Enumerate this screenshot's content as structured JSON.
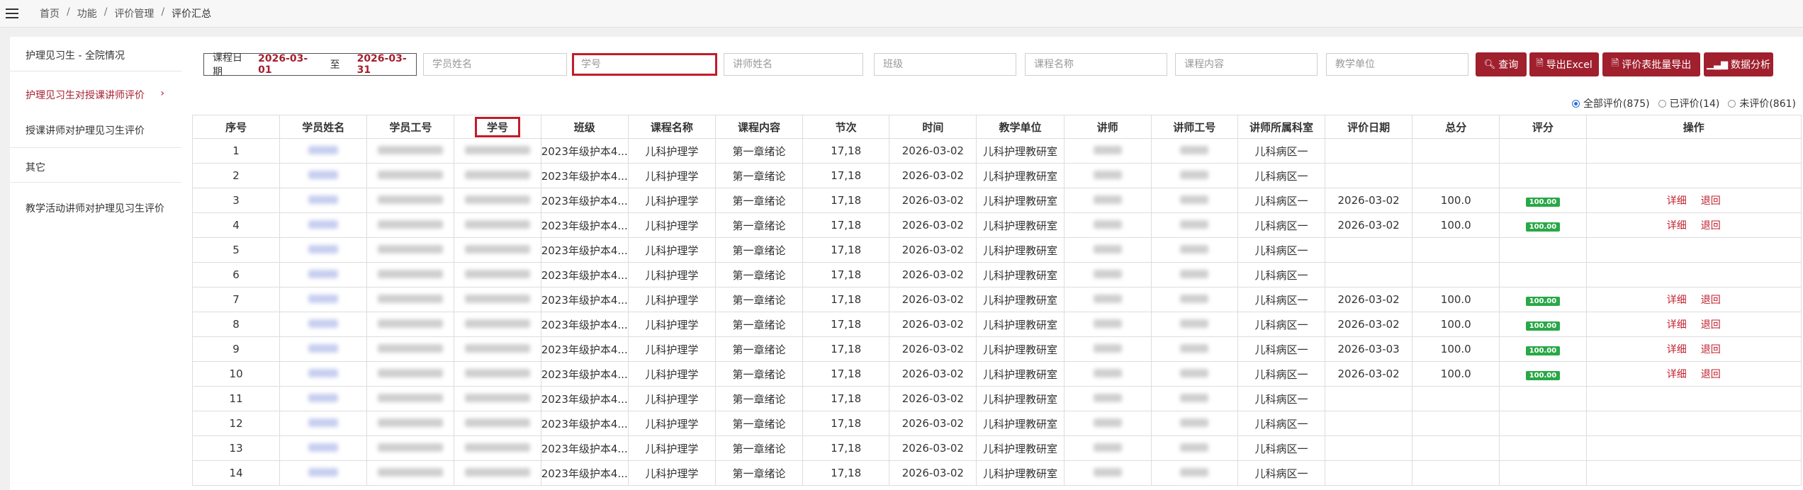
{
  "breadcrumb": [
    "首页",
    "功能",
    "评价管理",
    "评价汇总"
  ],
  "sidebar": {
    "items": [
      {
        "label": "护理见习生 - 全院情况",
        "active": false
      },
      {
        "label": "护理见习生对授课讲师评价",
        "active": true
      },
      {
        "label": "授课讲师对护理见习生评价",
        "active": false
      },
      {
        "label": "其它",
        "active": false
      },
      {
        "label": "教学活动讲师对护理见习生评价",
        "active": false
      }
    ],
    "active_chevron": "›"
  },
  "filters": {
    "date_label": "课程日期",
    "date_from": "2026-03-01",
    "date_to_word": "至",
    "date_to": "2026-03-31",
    "student_name_placeholder": "学员姓名",
    "student_no_placeholder": "学号",
    "teacher_name_placeholder": "讲师姓名",
    "class_placeholder": "班级",
    "course_name_placeholder": "课程名称",
    "course_content_placeholder": "课程内容",
    "teaching_unit_placeholder": "教学单位"
  },
  "buttons": {
    "query": "查询",
    "export_excel": "导出Excel",
    "batch_export": "评价表批量导出",
    "analysis": "数据分析"
  },
  "radios": [
    {
      "label": "全部评价(875)",
      "checked": true
    },
    {
      "label": "已评价(14)",
      "checked": false
    },
    {
      "label": "未评价(861)",
      "checked": false
    }
  ],
  "table": {
    "headers": [
      "序号",
      "学员姓名",
      "学员工号",
      "学号",
      "班级",
      "课程名称",
      "课程内容",
      "节次",
      "时间",
      "教学单位",
      "讲师",
      "讲师工号",
      "讲师所属科室",
      "评价日期",
      "总分",
      "评分",
      "操作"
    ],
    "highlighted_header": "学号",
    "ops": {
      "detail": "详细",
      "back": "退回"
    },
    "rows": [
      {
        "no": "1",
        "class": "2023年级护本4...",
        "course": "儿科护理学",
        "content": "第一章绪论",
        "section": "17,18",
        "time": "2026-03-02",
        "unit": "儿科护理教研室",
        "dept": "儿科病区一",
        "eval_date": "",
        "total": "",
        "score": ""
      },
      {
        "no": "2",
        "class": "2023年级护本4...",
        "course": "儿科护理学",
        "content": "第一章绪论",
        "section": "17,18",
        "time": "2026-03-02",
        "unit": "儿科护理教研室",
        "dept": "儿科病区一",
        "eval_date": "",
        "total": "",
        "score": ""
      },
      {
        "no": "3",
        "class": "2023年级护本4...",
        "course": "儿科护理学",
        "content": "第一章绪论",
        "section": "17,18",
        "time": "2026-03-02",
        "unit": "儿科护理教研室",
        "dept": "儿科病区一",
        "eval_date": "2026-03-02",
        "total": "100.0",
        "score": "100.00"
      },
      {
        "no": "4",
        "class": "2023年级护本4...",
        "course": "儿科护理学",
        "content": "第一章绪论",
        "section": "17,18",
        "time": "2026-03-02",
        "unit": "儿科护理教研室",
        "dept": "儿科病区一",
        "eval_date": "2026-03-02",
        "total": "100.0",
        "score": "100.00"
      },
      {
        "no": "5",
        "class": "2023年级护本4...",
        "course": "儿科护理学",
        "content": "第一章绪论",
        "section": "17,18",
        "time": "2026-03-02",
        "unit": "儿科护理教研室",
        "dept": "儿科病区一",
        "eval_date": "",
        "total": "",
        "score": ""
      },
      {
        "no": "6",
        "class": "2023年级护本4...",
        "course": "儿科护理学",
        "content": "第一章绪论",
        "section": "17,18",
        "time": "2026-03-02",
        "unit": "儿科护理教研室",
        "dept": "儿科病区一",
        "eval_date": "",
        "total": "",
        "score": ""
      },
      {
        "no": "7",
        "class": "2023年级护本4...",
        "course": "儿科护理学",
        "content": "第一章绪论",
        "section": "17,18",
        "time": "2026-03-02",
        "unit": "儿科护理教研室",
        "dept": "儿科病区一",
        "eval_date": "2026-03-02",
        "total": "100.0",
        "score": "100.00"
      },
      {
        "no": "8",
        "class": "2023年级护本4...",
        "course": "儿科护理学",
        "content": "第一章绪论",
        "section": "17,18",
        "time": "2026-03-02",
        "unit": "儿科护理教研室",
        "dept": "儿科病区一",
        "eval_date": "2026-03-02",
        "total": "100.0",
        "score": "100.00"
      },
      {
        "no": "9",
        "class": "2023年级护本4...",
        "course": "儿科护理学",
        "content": "第一章绪论",
        "section": "17,18",
        "time": "2026-03-02",
        "unit": "儿科护理教研室",
        "dept": "儿科病区一",
        "eval_date": "2026-03-03",
        "total": "100.0",
        "score": "100.00"
      },
      {
        "no": "10",
        "class": "2023年级护本4...",
        "course": "儿科护理学",
        "content": "第一章绪论",
        "section": "17,18",
        "time": "2026-03-02",
        "unit": "儿科护理教研室",
        "dept": "儿科病区一",
        "eval_date": "2026-03-02",
        "total": "100.0",
        "score": "100.00"
      },
      {
        "no": "11",
        "class": "2023年级护本4...",
        "course": "儿科护理学",
        "content": "第一章绪论",
        "section": "17,18",
        "time": "2026-03-02",
        "unit": "儿科护理教研室",
        "dept": "儿科病区一",
        "eval_date": "",
        "total": "",
        "score": ""
      },
      {
        "no": "12",
        "class": "2023年级护本4...",
        "course": "儿科护理学",
        "content": "第一章绪论",
        "section": "17,18",
        "time": "2026-03-02",
        "unit": "儿科护理教研室",
        "dept": "儿科病区一",
        "eval_date": "",
        "total": "",
        "score": ""
      },
      {
        "no": "13",
        "class": "2023年级护本4...",
        "course": "儿科护理学",
        "content": "第一章绪论",
        "section": "17,18",
        "time": "2026-03-02",
        "unit": "儿科护理教研室",
        "dept": "儿科病区一",
        "eval_date": "",
        "total": "",
        "score": ""
      },
      {
        "no": "14",
        "class": "2023年级护本4...",
        "course": "儿科护理学",
        "content": "第一章绪论",
        "section": "17,18",
        "time": "2026-03-02",
        "unit": "儿科护理教研室",
        "dept": "儿科病区一",
        "eval_date": "",
        "total": "",
        "score": ""
      }
    ]
  },
  "colors": {
    "brand": "#a0202e",
    "highlight": "#c21c2a",
    "score_badge": "#29a847"
  },
  "icons": {
    "menu": "hamburger-icon",
    "search": "search-icon",
    "excel": "file-export-icon",
    "batch": "file-export-icon",
    "chart": "bar-chart-icon"
  }
}
